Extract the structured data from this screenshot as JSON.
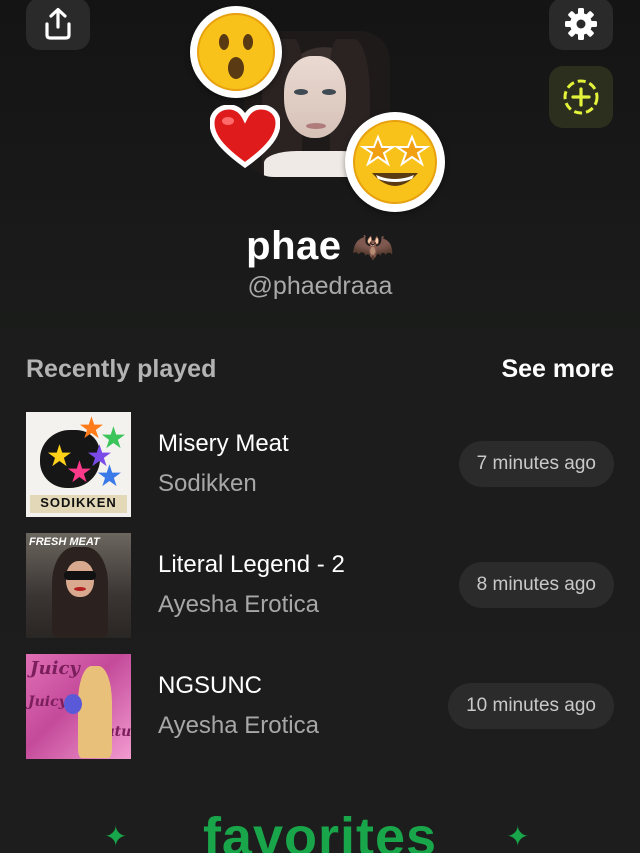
{
  "profile": {
    "name": "phae",
    "name_emoji": "🦇",
    "handle": "@phaedraaa",
    "avatar_emojis": [
      "😮",
      "❤️",
      "🤩"
    ]
  },
  "toolbar": {
    "share_icon": "share-upload-icon",
    "settings_icon": "gear-icon",
    "add_icon": "add-circle-icon",
    "accent_color": "#e3f23a"
  },
  "recently_played": {
    "title": "Recently played",
    "see_more": "See more",
    "tracks": [
      {
        "title": "Misery Meat",
        "artist": "Sodikken",
        "time": "7 minutes ago",
        "cover_label": "SODIKKEN"
      },
      {
        "title": "Literal Legend - 2",
        "artist": "Ayesha Erotica",
        "time": "8 minutes ago",
        "cover_label": "FRESH MEAT"
      },
      {
        "title": "NGSUNC",
        "artist": "Ayesha Erotica",
        "time": "10 minutes ago",
        "cover_label": "Juicy"
      }
    ]
  },
  "favorites": {
    "title": "favorites",
    "color": "#19a64a"
  }
}
